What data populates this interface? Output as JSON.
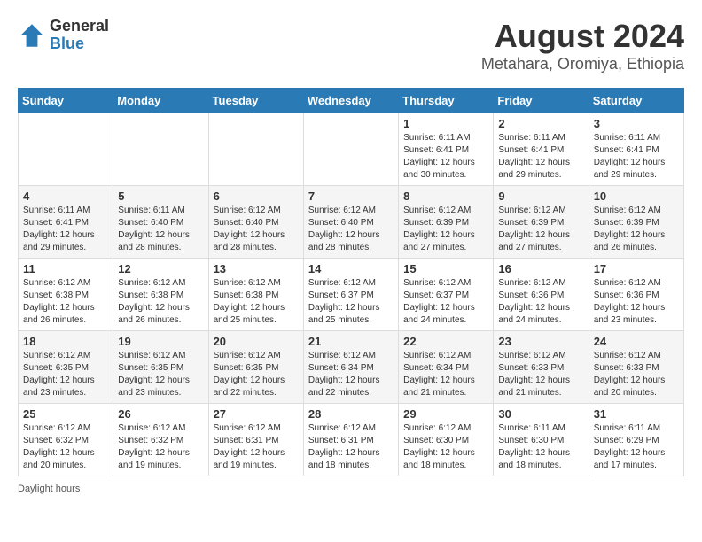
{
  "logo": {
    "general": "General",
    "blue": "Blue"
  },
  "title": {
    "month_year": "August 2024",
    "location": "Metahara, Oromiya, Ethiopia"
  },
  "days_of_week": [
    "Sunday",
    "Monday",
    "Tuesday",
    "Wednesday",
    "Thursday",
    "Friday",
    "Saturday"
  ],
  "legend": {
    "daylight_hours": "Daylight hours"
  },
  "weeks": [
    [
      {
        "day": "",
        "info": ""
      },
      {
        "day": "",
        "info": ""
      },
      {
        "day": "",
        "info": ""
      },
      {
        "day": "",
        "info": ""
      },
      {
        "day": "1",
        "info": "Sunrise: 6:11 AM\nSunset: 6:41 PM\nDaylight: 12 hours\nand 30 minutes."
      },
      {
        "day": "2",
        "info": "Sunrise: 6:11 AM\nSunset: 6:41 PM\nDaylight: 12 hours\nand 29 minutes."
      },
      {
        "day": "3",
        "info": "Sunrise: 6:11 AM\nSunset: 6:41 PM\nDaylight: 12 hours\nand 29 minutes."
      }
    ],
    [
      {
        "day": "4",
        "info": "Sunrise: 6:11 AM\nSunset: 6:41 PM\nDaylight: 12 hours\nand 29 minutes."
      },
      {
        "day": "5",
        "info": "Sunrise: 6:11 AM\nSunset: 6:40 PM\nDaylight: 12 hours\nand 28 minutes."
      },
      {
        "day": "6",
        "info": "Sunrise: 6:12 AM\nSunset: 6:40 PM\nDaylight: 12 hours\nand 28 minutes."
      },
      {
        "day": "7",
        "info": "Sunrise: 6:12 AM\nSunset: 6:40 PM\nDaylight: 12 hours\nand 28 minutes."
      },
      {
        "day": "8",
        "info": "Sunrise: 6:12 AM\nSunset: 6:39 PM\nDaylight: 12 hours\nand 27 minutes."
      },
      {
        "day": "9",
        "info": "Sunrise: 6:12 AM\nSunset: 6:39 PM\nDaylight: 12 hours\nand 27 minutes."
      },
      {
        "day": "10",
        "info": "Sunrise: 6:12 AM\nSunset: 6:39 PM\nDaylight: 12 hours\nand 26 minutes."
      }
    ],
    [
      {
        "day": "11",
        "info": "Sunrise: 6:12 AM\nSunset: 6:38 PM\nDaylight: 12 hours\nand 26 minutes."
      },
      {
        "day": "12",
        "info": "Sunrise: 6:12 AM\nSunset: 6:38 PM\nDaylight: 12 hours\nand 26 minutes."
      },
      {
        "day": "13",
        "info": "Sunrise: 6:12 AM\nSunset: 6:38 PM\nDaylight: 12 hours\nand 25 minutes."
      },
      {
        "day": "14",
        "info": "Sunrise: 6:12 AM\nSunset: 6:37 PM\nDaylight: 12 hours\nand 25 minutes."
      },
      {
        "day": "15",
        "info": "Sunrise: 6:12 AM\nSunset: 6:37 PM\nDaylight: 12 hours\nand 24 minutes."
      },
      {
        "day": "16",
        "info": "Sunrise: 6:12 AM\nSunset: 6:36 PM\nDaylight: 12 hours\nand 24 minutes."
      },
      {
        "day": "17",
        "info": "Sunrise: 6:12 AM\nSunset: 6:36 PM\nDaylight: 12 hours\nand 23 minutes."
      }
    ],
    [
      {
        "day": "18",
        "info": "Sunrise: 6:12 AM\nSunset: 6:35 PM\nDaylight: 12 hours\nand 23 minutes."
      },
      {
        "day": "19",
        "info": "Sunrise: 6:12 AM\nSunset: 6:35 PM\nDaylight: 12 hours\nand 23 minutes."
      },
      {
        "day": "20",
        "info": "Sunrise: 6:12 AM\nSunset: 6:35 PM\nDaylight: 12 hours\nand 22 minutes."
      },
      {
        "day": "21",
        "info": "Sunrise: 6:12 AM\nSunset: 6:34 PM\nDaylight: 12 hours\nand 22 minutes."
      },
      {
        "day": "22",
        "info": "Sunrise: 6:12 AM\nSunset: 6:34 PM\nDaylight: 12 hours\nand 21 minutes."
      },
      {
        "day": "23",
        "info": "Sunrise: 6:12 AM\nSunset: 6:33 PM\nDaylight: 12 hours\nand 21 minutes."
      },
      {
        "day": "24",
        "info": "Sunrise: 6:12 AM\nSunset: 6:33 PM\nDaylight: 12 hours\nand 20 minutes."
      }
    ],
    [
      {
        "day": "25",
        "info": "Sunrise: 6:12 AM\nSunset: 6:32 PM\nDaylight: 12 hours\nand 20 minutes."
      },
      {
        "day": "26",
        "info": "Sunrise: 6:12 AM\nSunset: 6:32 PM\nDaylight: 12 hours\nand 19 minutes."
      },
      {
        "day": "27",
        "info": "Sunrise: 6:12 AM\nSunset: 6:31 PM\nDaylight: 12 hours\nand 19 minutes."
      },
      {
        "day": "28",
        "info": "Sunrise: 6:12 AM\nSunset: 6:31 PM\nDaylight: 12 hours\nand 18 minutes."
      },
      {
        "day": "29",
        "info": "Sunrise: 6:12 AM\nSunset: 6:30 PM\nDaylight: 12 hours\nand 18 minutes."
      },
      {
        "day": "30",
        "info": "Sunrise: 6:11 AM\nSunset: 6:30 PM\nDaylight: 12 hours\nand 18 minutes."
      },
      {
        "day": "31",
        "info": "Sunrise: 6:11 AM\nSunset: 6:29 PM\nDaylight: 12 hours\nand 17 minutes."
      }
    ]
  ]
}
